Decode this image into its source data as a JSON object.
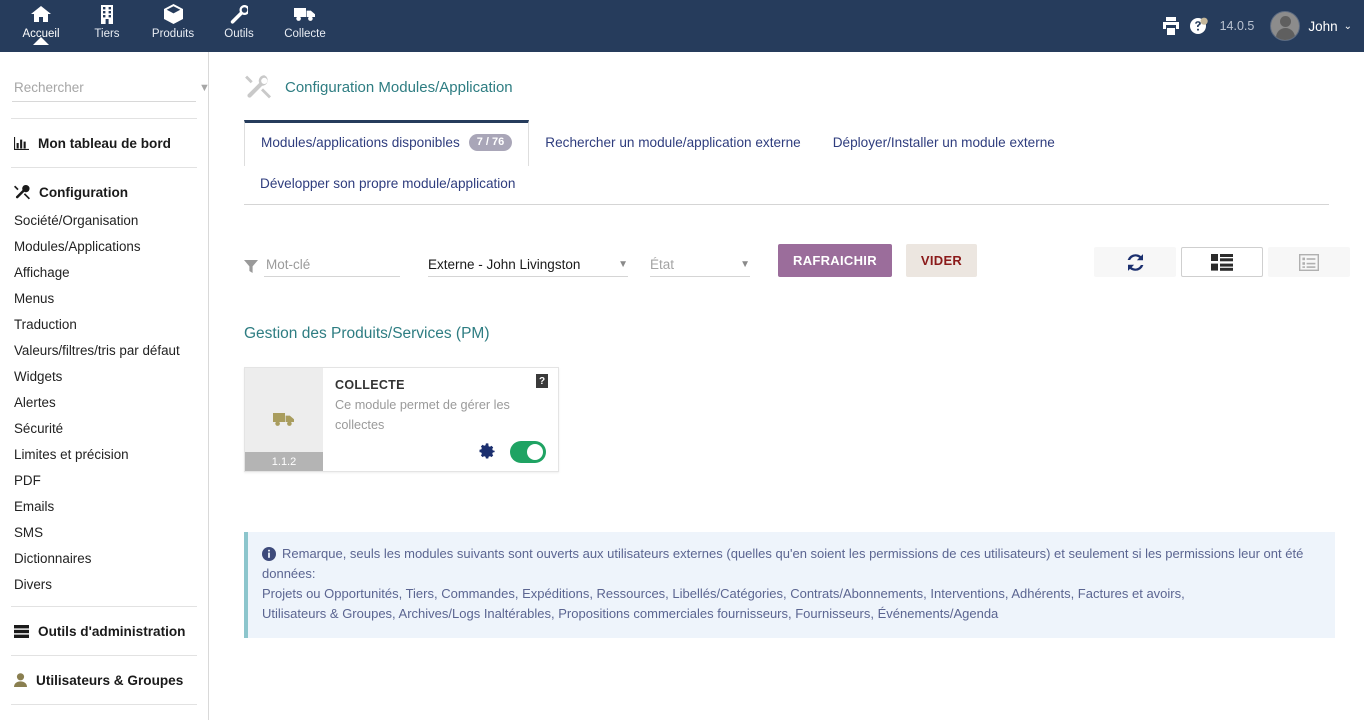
{
  "header": {
    "nav": [
      {
        "label": "Accueil",
        "icon": "home-icon",
        "active": true
      },
      {
        "label": "Tiers",
        "icon": "building-icon",
        "active": false
      },
      {
        "label": "Produits",
        "icon": "box-icon",
        "active": false
      },
      {
        "label": "Outils",
        "icon": "wrench-icon",
        "active": false
      },
      {
        "label": "Collecte",
        "icon": "truck-icon",
        "active": false
      }
    ],
    "print_icon": "printer-icon",
    "help_icon": "help-icon",
    "version": "14.0.5",
    "avatar": "user-avatar",
    "user_name": "John",
    "user_caret": "⌄",
    "bg_color": "#263c5c"
  },
  "sidebar": {
    "search": {
      "value": "",
      "placeholder": "Rechercher",
      "caret": "▼"
    },
    "dashboard": {
      "label": "Mon tableau de bord",
      "icon": "chart-icon"
    },
    "configuration": {
      "label": "Configuration",
      "icon": "tools-icon",
      "items": [
        "Société/Organisation",
        "Modules/Applications",
        "Affichage",
        "Menus",
        "Traduction",
        "Valeurs/filtres/tris par défaut",
        "Widgets",
        "Alertes",
        "Sécurité",
        "Limites et précision",
        "PDF",
        "Emails",
        "SMS",
        "Dictionnaires",
        "Divers"
      ]
    },
    "admin_tools": {
      "label": "Outils d'administration",
      "icon": "server-icon"
    },
    "users_groups": {
      "label": "Utilisateurs & Groupes",
      "icon": "user-icon"
    }
  },
  "page": {
    "title": "Configuration Modules/Application",
    "title_icon": "wrench-screwdriver-icon",
    "title_color": "#2e7d82"
  },
  "tabs": [
    {
      "label": "Modules/applications disponibles",
      "badge": "7 / 76",
      "active": true
    },
    {
      "label": "Rechercher un module/application externe",
      "badge": "",
      "active": false
    },
    {
      "label": "Déployer/Installer un module externe",
      "badge": "",
      "active": false
    },
    {
      "label": "Développer son propre module/application",
      "badge": "",
      "active": false
    }
  ],
  "toolbar": {
    "filter_icon": "filter-icon",
    "keyword": {
      "value": "",
      "placeholder": "Mot-clé"
    },
    "user_select": {
      "value": "Externe - John Livingston",
      "caret": "▼"
    },
    "state_select": {
      "value": "État",
      "caret": "▼"
    },
    "refresh_label": "RAFRAICHIR",
    "refresh_color": "#9b6d9b",
    "clear_label": "VIDER",
    "clear_color": "#ece6e0",
    "clear_text_color": "#8b1a1a",
    "reload_icon": "reload-icon",
    "grid_view_icon": "grid-view-icon",
    "list_view_icon": "list-view-icon"
  },
  "modules": {
    "section_title": "Gestion des Produits/Services (PM)",
    "cards": [
      {
        "name": "COLLECTE",
        "description": "Ce module permet de gérer les collectes",
        "version": "1.1.2",
        "icon": "truck-icon",
        "icon_color": "#a99d5e",
        "help_badge": "?",
        "gear_icon": "gear-icon",
        "enabled": true,
        "toggle_color": "#1fa363"
      }
    ]
  },
  "notice": {
    "icon": "info-icon",
    "line1": "Remarque, seuls les modules suivants sont ouverts aux utilisateurs externes (quelles qu'en soient les permissions de ces utilisateurs) et seulement si les permissions leur ont été données:",
    "line2": "Projets ou Opportunités, Tiers, Commandes, Expéditions, Ressources, Libellés/Catégories, Contrats/Abonnements, Interventions, Adhérents, Factures et avoirs,",
    "line3": "Utilisateurs & Groupes, Archives/Logs Inaltérables, Propositions commerciales fournisseurs, Fournisseurs, Événements/Agenda",
    "bg_color": "#eef4fb",
    "border_color": "#8cc5cc"
  }
}
